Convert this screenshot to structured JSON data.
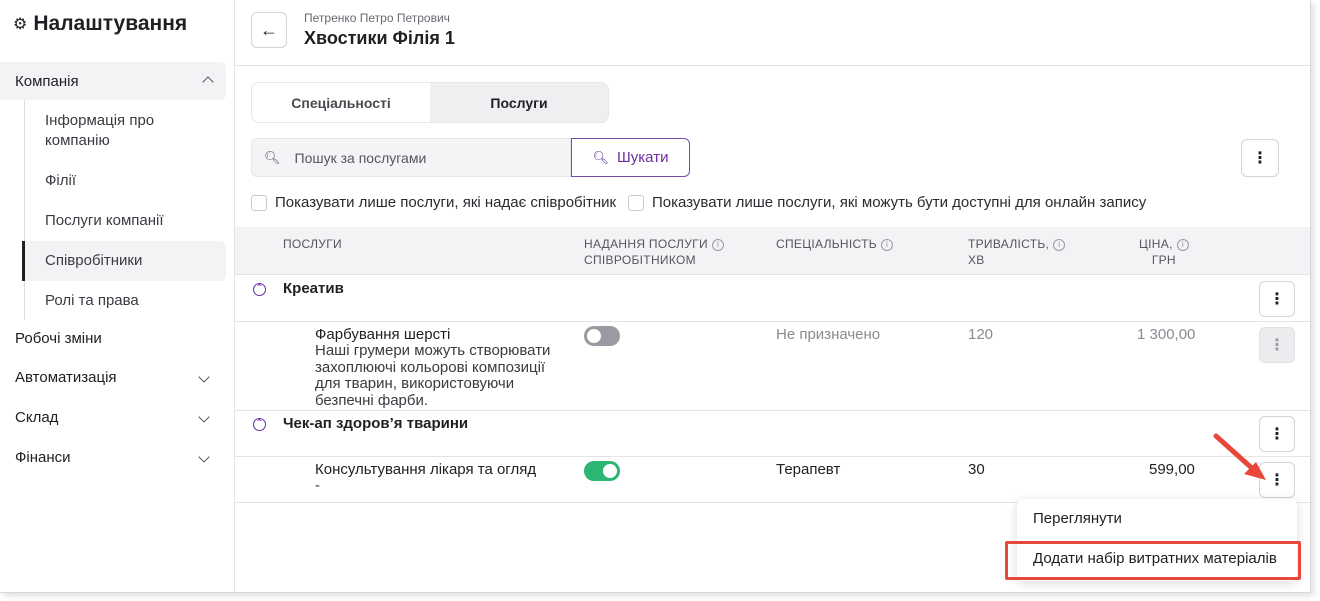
{
  "sidebar": {
    "title": "Налаштування",
    "company": "Компанія",
    "sub_items": [
      "Інформація про компанію",
      "Філії",
      "Послуги компанії",
      "Співробітники",
      "Ролі та права"
    ],
    "items": [
      "Робочі зміни",
      "Автоматизація",
      "Склад",
      "Фінанси"
    ]
  },
  "header": {
    "employee": "Петренко Петро Петрович",
    "title": "Хвостики Філія 1"
  },
  "tabs": [
    "Спеціальності",
    "Послуги"
  ],
  "search": {
    "placeholder": "Пошук за послугами",
    "button": "Шукати"
  },
  "filters": [
    "Показувати лише послуги, які надає співробітник",
    "Показувати лише послуги, які можуть бути доступні для онлайн запису"
  ],
  "table": {
    "columns": {
      "services": "ПОСЛУГИ",
      "provision_1": "НАДАННЯ ПОСЛУГИ",
      "provision_2": "СПІВРОБІТНИКОМ",
      "specialty": "СПЕЦІАЛЬНІСТЬ",
      "duration_1": "ТРИВАЛІСТЬ,",
      "duration_2": "ХВ",
      "price_1": "ЦІНА,",
      "price_2": "ГРН"
    },
    "groups": [
      {
        "name": "Креатив",
        "services": [
          {
            "name": "Фарбування шерсті",
            "description": "Наші грумери можуть створювати захоплюючі кольорові композиції для тварин, використовуючи безпечні фарби.",
            "enabled": false,
            "specialty": "Не призначено",
            "duration": "120",
            "price": "1 300,00"
          }
        ]
      },
      {
        "name": "Чек-ап здоров’я тварини",
        "services": [
          {
            "name": "Консультування лікаря та огляд",
            "description": "-",
            "enabled": true,
            "specialty": "Терапевт",
            "duration": "30",
            "price": "599,00"
          }
        ]
      }
    ]
  },
  "menu": {
    "view": "Переглянути",
    "add_kit": "Додати набір витратних матеріалів"
  },
  "colors": {
    "accent": "#6a2f9e",
    "toggle_on": "#2bb673",
    "toggle_off": "#9a9aa2",
    "highlight": "#e8473a"
  }
}
